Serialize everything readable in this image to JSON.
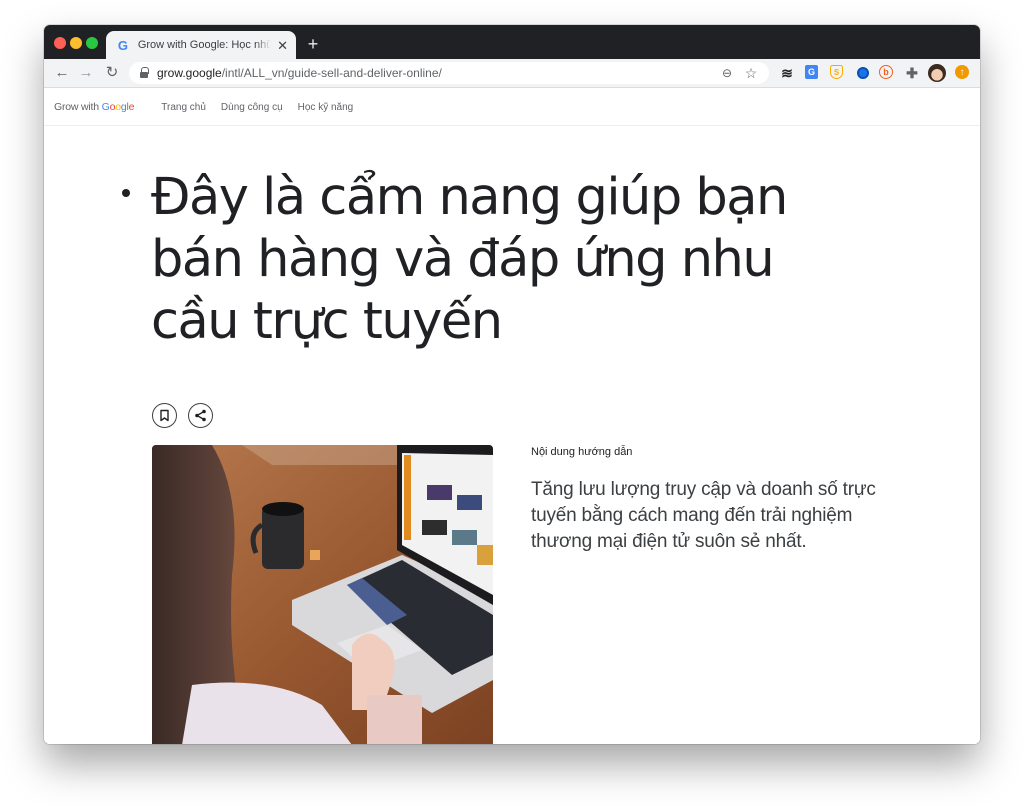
{
  "browser": {
    "tab": {
      "favicon": "G",
      "title": "Grow with Google: Học những",
      "close": "✕"
    },
    "new_tab": "+",
    "nav": {
      "back": "←",
      "forward": "→",
      "reload": "↻"
    },
    "url": {
      "host": "grow.google",
      "path": "/intl/ALL_vn/guide-sell-and-deliver-online/"
    },
    "omnibox_icons": {
      "zoom": "⊖",
      "star": "☆"
    },
    "extensions": [
      {
        "name": "buffer",
        "glyph": "≋"
      },
      {
        "name": "google-translate",
        "glyph": "G"
      },
      {
        "name": "shield",
        "glyph": "S"
      },
      {
        "name": "blue-circle",
        "glyph": ""
      },
      {
        "name": "bitly",
        "glyph": "b"
      },
      {
        "name": "extensions-puzzle",
        "glyph": "✚"
      },
      {
        "name": "profile-avatar",
        "glyph": ""
      },
      {
        "name": "update",
        "glyph": "↑"
      }
    ]
  },
  "site": {
    "logo": {
      "prefix": "Grow with ",
      "brand": [
        "G",
        "o",
        "o",
        "g",
        "l",
        "e"
      ]
    },
    "nav": [
      "Trang chủ",
      "Dùng công cụ",
      "Học kỹ năng"
    ]
  },
  "article": {
    "headline": "Đây là cẩm nang giúp bạn bán hàng và đáp ứng nhu cầu trực tuyến",
    "actions": {
      "bookmark": "bookmark",
      "share": "share"
    },
    "guide_label": "Nội dung hướng dẫn",
    "guide_description": "Tăng lưu lượng truy cập và doanh số trực tuyến bằng cách mang đến trải nghiệm thương mại điện tử suôn sẻ nhất.",
    "image_alt": "Woman using a laptop on a wooden desk next to a coffee mug"
  }
}
